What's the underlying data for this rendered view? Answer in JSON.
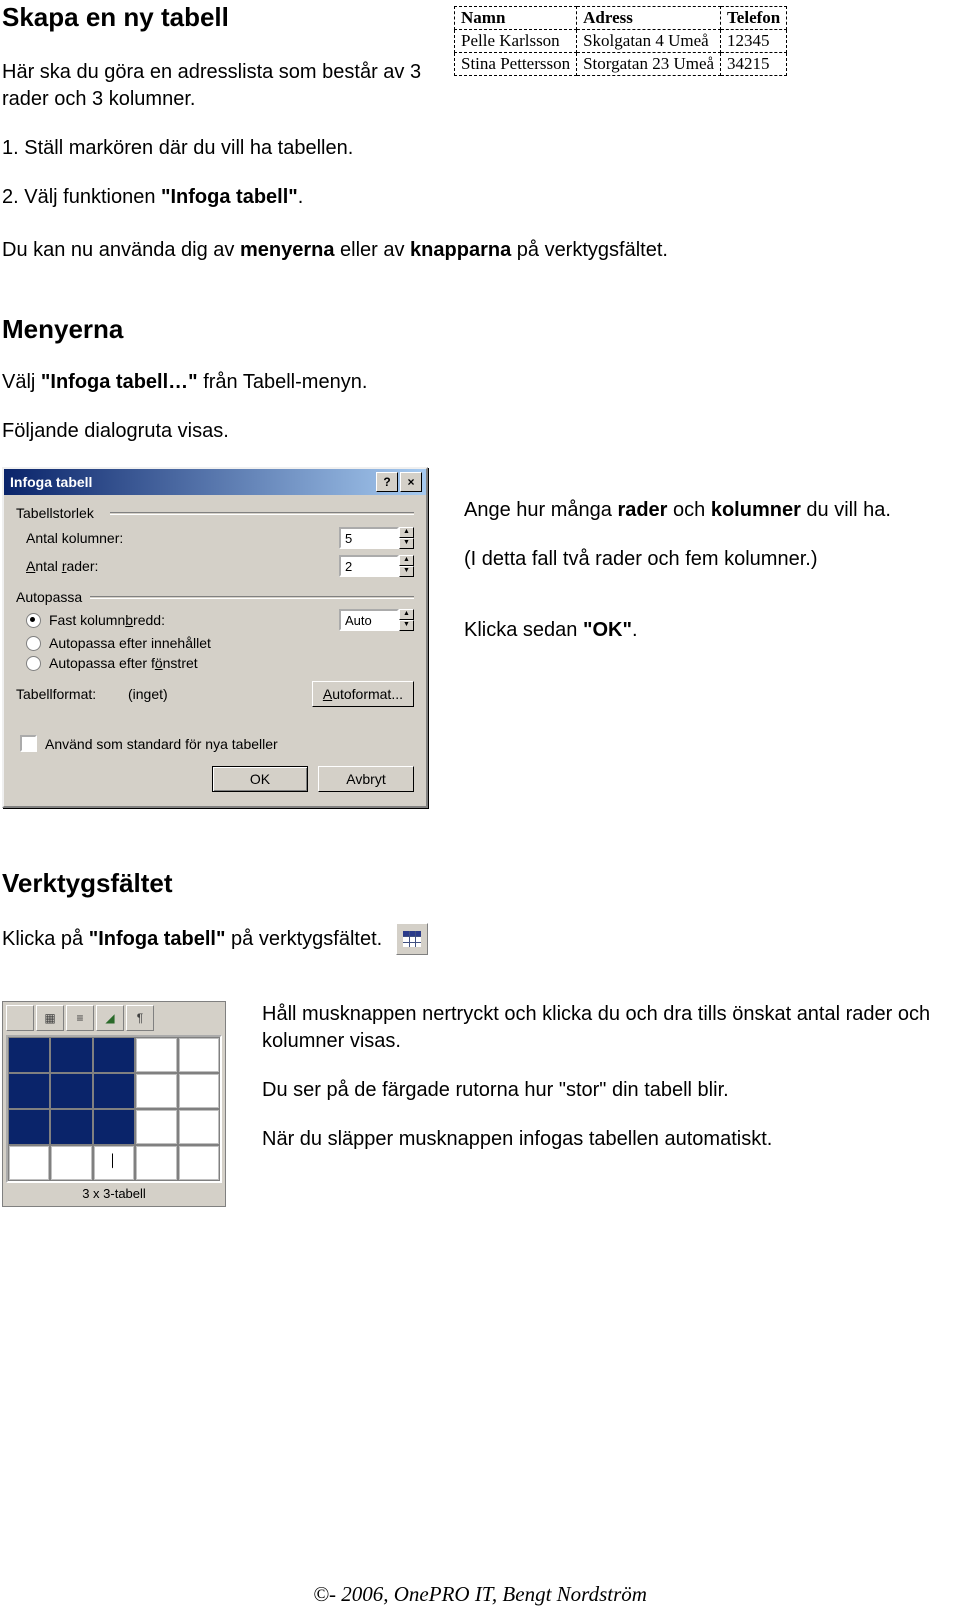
{
  "title": "Skapa en ny tabell",
  "intro1": "Här ska du göra en adresslista som består av 3 rader och 3 kolumner.",
  "step1": "1. Ställ markören där du vill ha tabellen.",
  "step2a": "2. Välj funktionen ",
  "step2b": "\"Infoga tabell\"",
  "step2c": ".",
  "sentence3a": "Du kan nu använda dig av ",
  "sentence3b": "menyerna",
  "sentence3c": " eller av ",
  "sentence3d": "knapparna",
  "sentence3e": " på verktygsfältet.",
  "menusHeading": "Menyerna",
  "menus1a": "Välj ",
  "menus1b": "\"Infoga tabell…\"",
  "menus1c": " från Tabell-menyn.",
  "menus2": "Följande dialogruta visas.",
  "side1a": "Ange hur många ",
  "side1b": "rader",
  "side1c": " och ",
  "side1d": "kolumner",
  "side1e": " du vill ha.",
  "side2": "(I detta fall två rader och fem kolumner.)",
  "side3a": "Klicka sedan ",
  "side3b": "\"OK\"",
  "side3c": ".",
  "toolbarHeading": "Verktygsfältet",
  "toolbarText1a": "Klicka på ",
  "toolbarText1b": "\"Infoga tabell\"",
  "toolbarText1c": " på verktygsfältet.",
  "drag1": "Håll musknappen nertryckt och klicka du och dra tills önskat antal rader och kolumner visas.",
  "drag2": "Du ser på de färgade rutorna hur \"stor\" din tabell blir.",
  "drag3": "När du släpper musknappen infogas tabellen automatiskt.",
  "gridStatus": "3 x 3-tabell",
  "footer": "©- 2006, OnePRO IT, Bengt Nordström",
  "example": {
    "headers": [
      "Namn",
      "Adress",
      "Telefon"
    ],
    "rows": [
      [
        "Pelle Karlsson",
        "Skolgatan 4  Umeå",
        "12345"
      ],
      [
        "Stina Pettersson",
        "Storgatan 23  Umeå",
        "34215"
      ]
    ]
  },
  "dialog": {
    "title": "Infoga tabell",
    "grpSize": "Tabellstorlek",
    "colLabel": "Antal kolumner:",
    "colValue": "5",
    "rowLabel": "Antal rader:",
    "rowValue": "2",
    "grpAuto": "Autopassa",
    "r1": "Fast kolumnbredd:",
    "r1val": "Auto",
    "r2": "Autopassa efter innehållet",
    "r3": "Autopassa efter fönstret",
    "fmtLabel": "Tabellformat:",
    "fmtVal": "(inget)",
    "autofmt": "Autoformat...",
    "stdChk": "Använd som standard för nya tabeller",
    "ok": "OK",
    "cancel": "Avbryt"
  }
}
